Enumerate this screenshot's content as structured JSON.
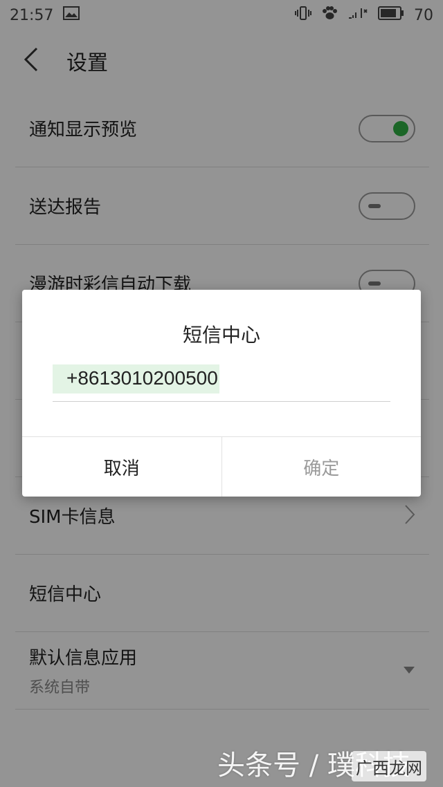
{
  "status_bar": {
    "time": "21:57",
    "battery": "70"
  },
  "header": {
    "title": "设置"
  },
  "settings": {
    "notification_preview": {
      "label": "通知显示预览",
      "enabled": true
    },
    "delivery_report": {
      "label": "送达报告",
      "enabled": false
    },
    "roaming_mms_download": {
      "label": "漫游时彩信自动下载",
      "enabled": false
    },
    "sim_info": {
      "label": "SIM卡信息"
    },
    "sms_center": {
      "label": "短信中心"
    },
    "default_app": {
      "label": "默认信息应用",
      "value": "系统自带"
    }
  },
  "dialog": {
    "title": "短信中心",
    "value": "+8613010200500",
    "cancel_label": "取消",
    "confirm_label": "确定"
  },
  "watermark": {
    "text": "头条号 / 璞科技",
    "logo_text": "广西龙网"
  }
}
